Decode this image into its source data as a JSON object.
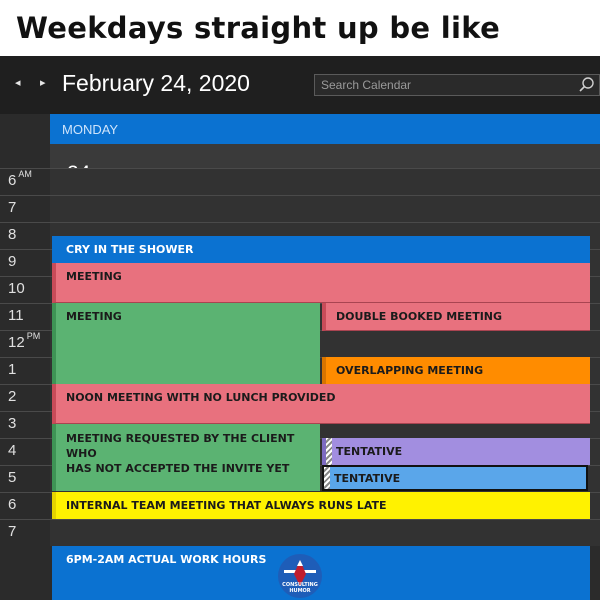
{
  "caption": "Weekdays straight up be like",
  "header": {
    "prev_icon": "◂",
    "next_icon": "▸",
    "date_title": "February 24, 2020",
    "search_placeholder": "Search Calendar"
  },
  "day": {
    "name": "MONDAY",
    "number": "24"
  },
  "hours": [
    {
      "label": "6",
      "suffix": "AM"
    },
    {
      "label": "7",
      "suffix": ""
    },
    {
      "label": "8",
      "suffix": ""
    },
    {
      "label": "9",
      "suffix": ""
    },
    {
      "label": "10",
      "suffix": ""
    },
    {
      "label": "11",
      "suffix": ""
    },
    {
      "label": "12",
      "suffix": "PM"
    },
    {
      "label": "1",
      "suffix": ""
    },
    {
      "label": "2",
      "suffix": ""
    },
    {
      "label": "3",
      "suffix": ""
    },
    {
      "label": "4",
      "suffix": ""
    },
    {
      "label": "5",
      "suffix": ""
    },
    {
      "label": "6",
      "suffix": ""
    },
    {
      "label": "7",
      "suffix": ""
    }
  ],
  "events": {
    "cry": "CRY IN THE SHOWER",
    "meeting1": "MEETING",
    "meeting2": "MEETING",
    "double_booked": "DOUBLE BOOKED MEETING",
    "overlapping": "OVERLAPPING MEETING",
    "noon": "NOON MEETING WITH NO LUNCH PROVIDED",
    "client_line1": "MEETING REQUESTED BY THE CLIENT WHO",
    "client_line2": "HAS NOT ACCEPTED THE INVITE YET",
    "tentative1": "TENTATIVE",
    "tentative2": "TENTATIVE",
    "internal": "INTERNAL TEAM MEETING THAT ALWAYS RUNS LATE",
    "work_hours": "6PM-2AM ACTUAL WORK HOURS"
  },
  "logo": {
    "line1": "CONSULTING",
    "line2": "HUMOR"
  },
  "colors": {
    "accent_blue": "#0b72d1",
    "pink": "#e8717e",
    "green": "#5bb372",
    "orange": "#ff8c00",
    "purple": "#a28ee0",
    "light_blue": "#5aa6ea",
    "yellow": "#fff200"
  }
}
